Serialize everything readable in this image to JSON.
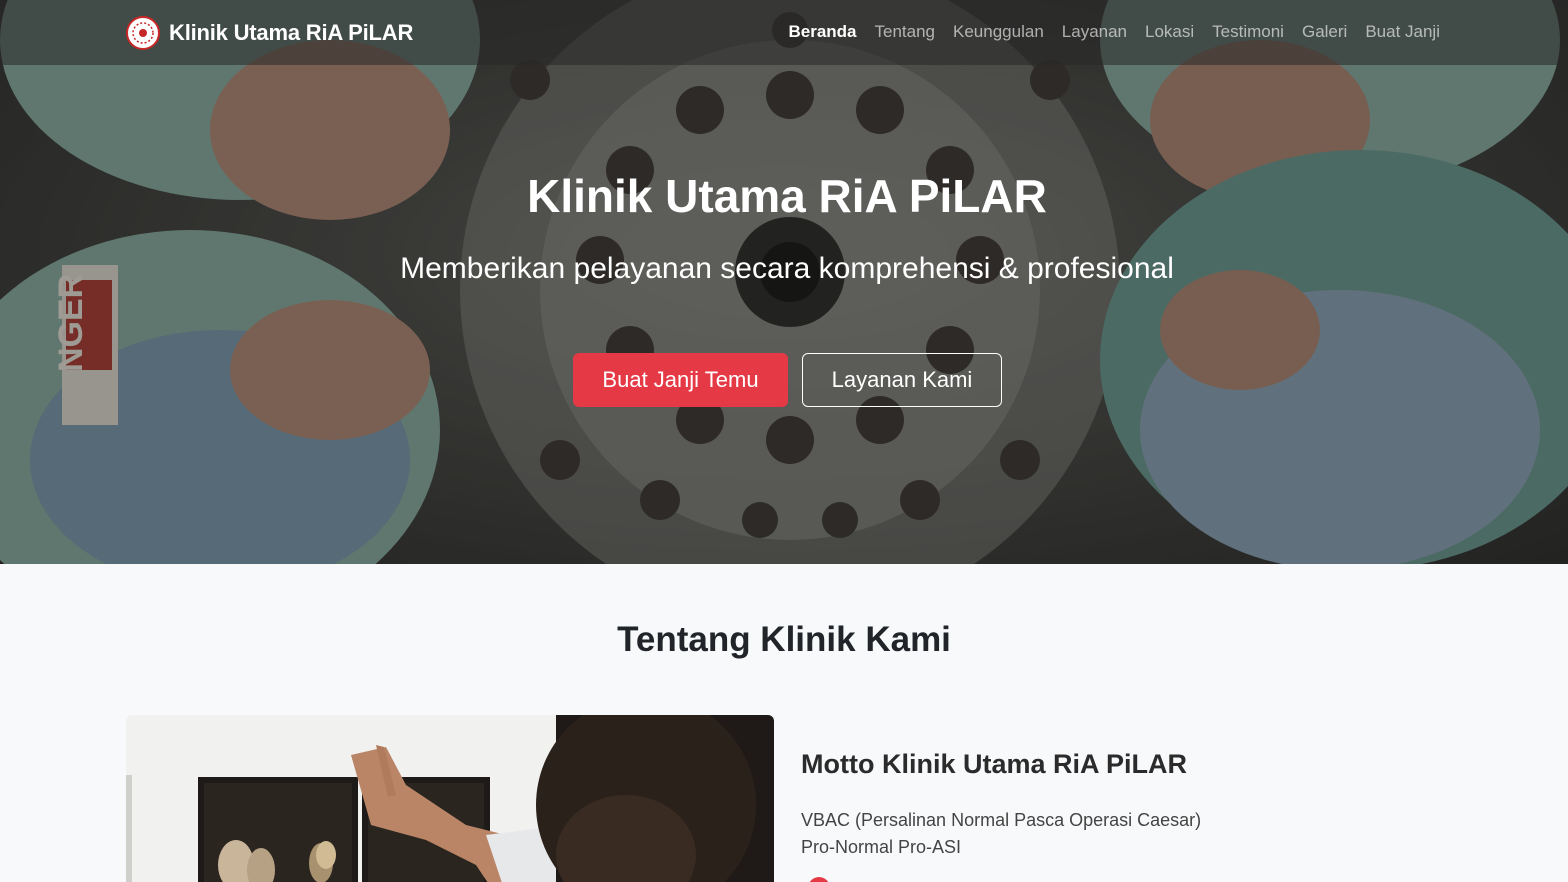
{
  "nav": {
    "brand": "Klinik Utama RiA PiLAR",
    "links": [
      "Beranda",
      "Tentang",
      "Keunggulan",
      "Layanan",
      "Lokasi",
      "Testimoni",
      "Galeri",
      "Buat Janji"
    ],
    "active": "Beranda"
  },
  "hero": {
    "title": "Klinik Utama RiA PiLAR",
    "subtitle": "Memberikan pelayanan secara komprehensi & profesional",
    "primary_button": "Buat Janji Temu",
    "secondary_button": "Layanan Kami",
    "background_text": "NGER"
  },
  "about": {
    "section_title": "Tentang Klinik Kami",
    "motto_title": "Motto Klinik Utama RiA PiLAR",
    "motto_lines": [
      "VBAC (Persalinan Normal Pasca Operasi Caesar)",
      "Pro-Normal Pro-ASI"
    ]
  },
  "colors": {
    "accent": "#e63946",
    "nav_bg": "rgba(40,40,40,0.55)",
    "page_bg": "#f8f9fa"
  },
  "icons": {
    "brand_logo": "clinic-logo-icon",
    "dot": "red-dot-icon"
  }
}
